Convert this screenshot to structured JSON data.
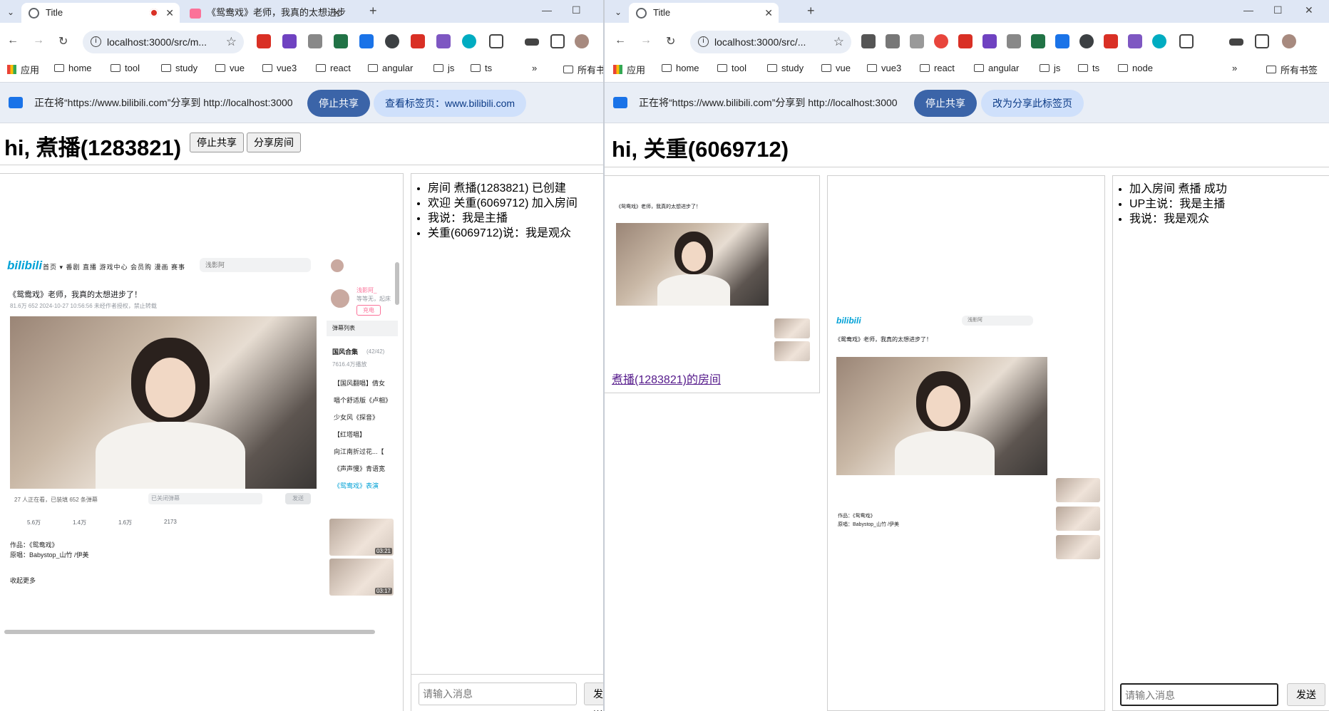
{
  "left": {
    "tabs": [
      {
        "title": "Title"
      },
      {
        "title": "《鸳鸯戏》老师，我真的太想进步了！"
      }
    ],
    "address": "localhost:3000/src/m...",
    "bookmarks": [
      "应用",
      "home",
      "tool",
      "study",
      "vue",
      "vue3",
      "react",
      "angular",
      "js",
      "ts",
      "所有书"
    ],
    "share": {
      "text": "正在将“https://www.bilibili.com”分享到 http://localhost:3000",
      "stop": "停止共享",
      "view": "查看标签页：www.bilibili.com"
    },
    "page": {
      "greeting": "hi, 煮播(1283821)",
      "stop_button": "停止共享",
      "share_room_button": "分享房间",
      "messages": [
        "房间 煮播(1283821) 已创建",
        "欢迎 关重(6069712) 加入房间",
        "我说：我是主播",
        "关重(6069712)说：我是观众"
      ],
      "input_placeholder": "请输入消息",
      "send": "发送"
    },
    "bili": {
      "logo": "bilibili",
      "nav": "首页 ▾  番剧  直播  游戏中心  会员购  漫画  赛事",
      "search": "浅影阿",
      "title": "《鸳鸯戏》老师，我真的太想进步了！",
      "meta": "81.6万  652  2024-10-27 10:56:56  未经作者授权，禁止转载",
      "uploader": "浅影阿_",
      "uploader_sub": "等等无，起床",
      "charge": "充电",
      "danmaku_list": "弹幕列表",
      "playlist_title": "国风合集",
      "playlist_count": "(42/42)",
      "playlist_views": "7616.4万播放",
      "list": [
        "【国风翻唱】倩女",
        "唱个舒适版《卢相》",
        "少女风《探音》",
        "【红塔唱】",
        "向江南折过花...【",
        "《声声慢》青语宽",
        "《鸳鸯戏》表演"
      ],
      "danmaku_bar": "27 人正在看，已装填 652 条弹幕",
      "danmaku_input": "已关闭弹幕",
      "danmaku_send": "发送",
      "stats": [
        "5.6万",
        "1.4万",
        "1.6万",
        "2173"
      ],
      "info1": "作品：《鸳鸯戏》",
      "info2": "原唱：Babystop_山竹 /伊美",
      "info3": "收起更多",
      "durations": [
        "03:21",
        "03:17"
      ]
    }
  },
  "right": {
    "tabs": [
      {
        "title": "Title"
      }
    ],
    "address": "localhost:3000/src/...",
    "bookmarks": [
      "应用",
      "home",
      "tool",
      "study",
      "vue",
      "vue3",
      "react",
      "angular",
      "js",
      "ts",
      "node",
      "所有书签"
    ],
    "share": {
      "text": "正在将“https://www.bilibili.com”分享到 http://localhost:3000",
      "stop": "停止共享",
      "switch": "改为分享此标签页"
    },
    "page": {
      "greeting": "hi, 关重(6069712)",
      "room_link": "煮播(1283821)的房间",
      "messages": [
        "加入房间 煮播 成功",
        "UP主说：我是主播",
        "我说：我是观众"
      ],
      "input_placeholder": "请输入消息",
      "send": "发送"
    }
  }
}
